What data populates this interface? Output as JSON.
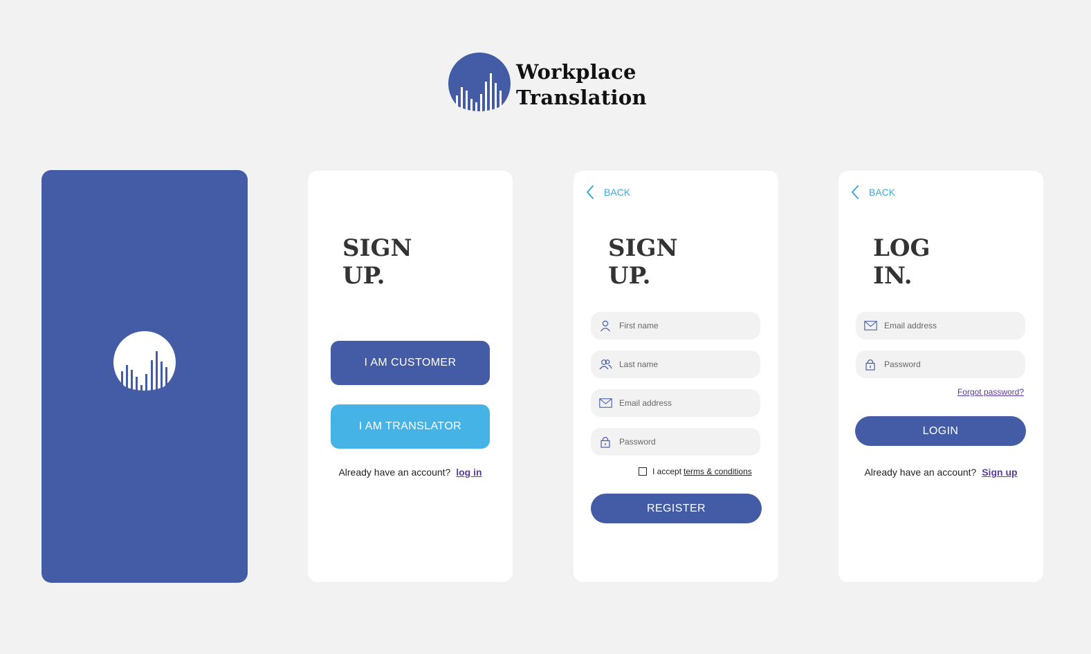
{
  "brand": {
    "name_line1": "Workplace",
    "name_line2": "Translation",
    "logo_icon": "bar-chart-circle-icon",
    "primary_color": "#445ca6",
    "accent_color": "#45b3e6",
    "link_color": "#5a3aa0"
  },
  "splash": {
    "logo_icon": "bar-chart-circle-icon"
  },
  "choose": {
    "heading_line1": "SIGN",
    "heading_line2": "UP.",
    "customer_label": "I AM CUSTOMER",
    "translator_label": "I AM TRANSLATOR",
    "account_prompt": "Already have an account?",
    "login_link": "log in"
  },
  "register": {
    "back_label": "BACK",
    "heading_line1": "SIGN",
    "heading_line2": "UP.",
    "first_name_placeholder": "First name",
    "last_name_placeholder": "Last name",
    "email_placeholder": "Email address",
    "password_placeholder": "Password",
    "terms_prefix": "I accept",
    "terms_link": "terms & conditions",
    "register_label": "REGISTER"
  },
  "login": {
    "back_label": "BACK",
    "heading_line1": "LOG",
    "heading_line2": "IN.",
    "email_placeholder": "Email address",
    "password_placeholder": "Password",
    "forgot_label": "Forgot password?",
    "login_label": "LOGIN",
    "account_prompt": "Already have an account?",
    "signup_link": "Sign up"
  }
}
